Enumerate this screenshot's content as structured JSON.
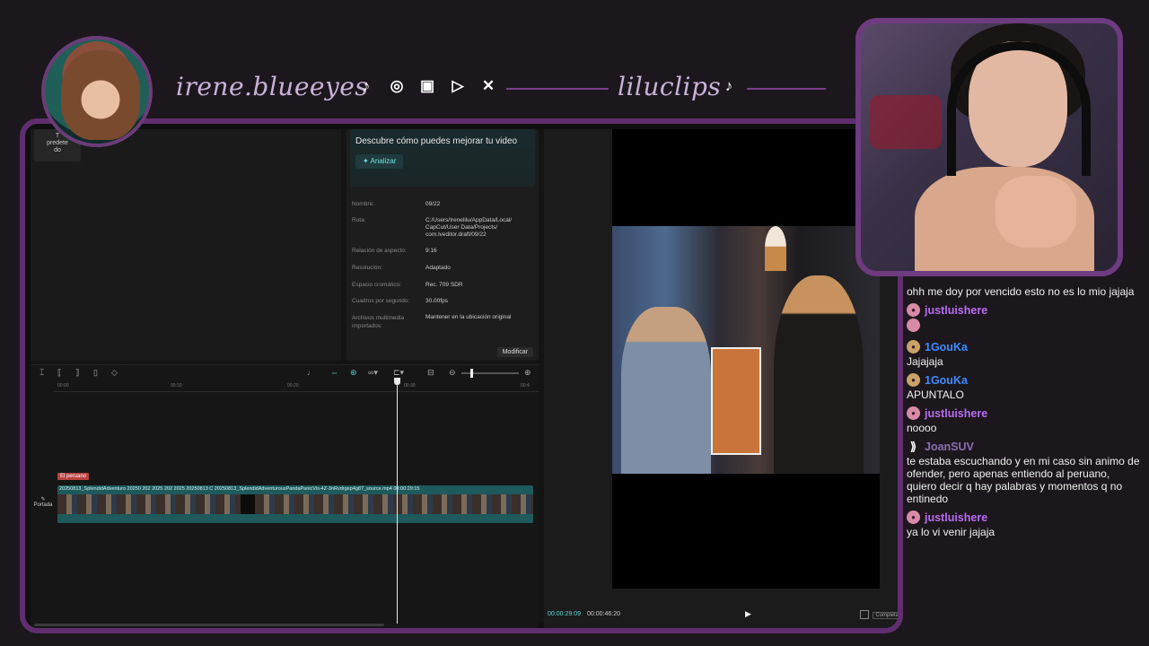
{
  "overlay": {
    "handle_main": "irene.blueeyes",
    "handle_second": "liluclips",
    "social_icons": [
      "tiktok-icon",
      "instagram-icon",
      "twitch-icon",
      "youtube-icon",
      "x-icon"
    ],
    "accent": "#6e3a80"
  },
  "media": {
    "thumb_label": "T\npredete\ndo"
  },
  "details": {
    "title": "Descubre cómo puedes mejorar tu video",
    "analyze_label": "Analizar",
    "rows": [
      {
        "k": "Nombre:",
        "v": "09/22"
      },
      {
        "k": "Ruta:",
        "v": "C:/Users/Irenelilu/AppData/Local/\nCapCut/User Data/Projects/\ncom.lveditor.draft/09/22"
      },
      {
        "k": "Relación de aspecto:",
        "v": "9:16"
      },
      {
        "k": "Resolución:",
        "v": "Adaptado"
      },
      {
        "k": "Espacio cromático:",
        "v": "Rec. 709 SDR"
      },
      {
        "k": "Cuadros por segundo:",
        "v": "30.00fps"
      },
      {
        "k": "Archivos multimedia importados:",
        "v": "Mantener en la ubicación original"
      }
    ],
    "modify_label": "Modificar"
  },
  "timeline": {
    "ruler": [
      "00:00",
      "00:10",
      "00:20",
      "00:30",
      "00:4"
    ],
    "label_tag": "El peruano",
    "cover_label": "Portada",
    "clip_names": "20250813_SplendidAdventuro  20250  202  2025  202  2025  20250813  C  20250813_SplendidAdventurousPandaPanicVis-4Z-3nRvdrgep4g87_source.mp4  00:00:29:15"
  },
  "player": {
    "current_time": "00:00:29:09",
    "total_time": "00:00:46:20",
    "full_label": "Completa"
  },
  "chat": {
    "messages": [
      {
        "user": "",
        "badge": "",
        "text": "ohh me doy por vencido esto no es lo mio jajaja",
        "color": "#ffffff"
      },
      {
        "user": "justluishere",
        "badge": "pink",
        "text": "",
        "emote": true,
        "color": "#b86cf0"
      },
      {
        "user": "1GouKa",
        "badge": "gold",
        "text": "Jajajaja",
        "color": "#3d8cff"
      },
      {
        "user": "1GouKa",
        "badge": "gold",
        "text": "APUNTALO",
        "color": "#3d8cff"
      },
      {
        "user": "justluishere",
        "badge": "pink",
        "text": "noooo",
        "color": "#b86cf0"
      },
      {
        "user": "JoanSUV",
        "badge": "logo",
        "text": "te estaba escuchando y en mi caso sin animo de ofender, pero apenas entiendo al peruano, quiero decir q hay palabras y momentos q no entinedo",
        "color": "#8a6fb0"
      },
      {
        "user": "justluishere",
        "badge": "pink",
        "text": "ya lo vi venir jajaja",
        "color": "#b86cf0"
      }
    ]
  }
}
